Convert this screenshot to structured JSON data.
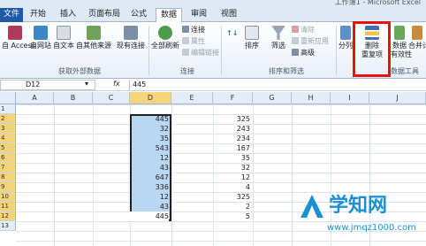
{
  "window": {
    "title": "工作簿1 - Microsoft Excel"
  },
  "tabs": [
    {
      "label": "文件",
      "state": "file"
    },
    {
      "label": "开始"
    },
    {
      "label": "插入"
    },
    {
      "label": "页面布局"
    },
    {
      "label": "公式"
    },
    {
      "label": "数据",
      "state": "active"
    },
    {
      "label": "审阅"
    },
    {
      "label": "视图"
    }
  ],
  "ribbon": {
    "groups": {
      "external": "获取外部数据",
      "connections": "连接",
      "sort_filter": "排序和筛选",
      "data_tools": "数据工具"
    },
    "buttons": {
      "access": "自 Access",
      "web": "自网站",
      "text": "自文本",
      "other": "自其他来源",
      "existing": "现有连接",
      "refresh": "全部刷新",
      "conn": "连接",
      "props": "属性",
      "edit_links": "编辑链接",
      "sort": "排序",
      "filter": "筛选",
      "clear": "清除",
      "reapply": "重新应用",
      "advanced": "高级",
      "split": "分列",
      "remove_dup_line1": "删除",
      "remove_dup_line2": "重复项",
      "validation_line1": "数据",
      "validation_line2": "有效性",
      "consolidate": "合并计"
    }
  },
  "formula_bar": {
    "name_box": "D12",
    "fx": "fx",
    "value": "445"
  },
  "columns": [
    "A",
    "B",
    "C",
    "D",
    "E",
    "F",
    "G",
    "H",
    "I",
    "J"
  ],
  "rows": [
    "1",
    "2",
    "3",
    "4",
    "5",
    "6",
    "7",
    "8",
    "9",
    "10",
    "11",
    "12",
    "13"
  ],
  "column_d": [
    "445",
    "32",
    "35",
    "543",
    "12",
    "43",
    "647",
    "336",
    "12",
    "43",
    "445"
  ],
  "column_f": [
    "325",
    "243",
    "234",
    "167",
    "35",
    "32",
    "12",
    "4",
    "325",
    "2",
    "5"
  ],
  "watermark": {
    "brand": "学知网",
    "url": "www.jmqz1000.com"
  },
  "colors": {
    "selection": "#b9d6f2",
    "highlight_box": "#e81010",
    "file_tab": "#1e5aa8",
    "watermark_blue": "#1a8fd6"
  }
}
